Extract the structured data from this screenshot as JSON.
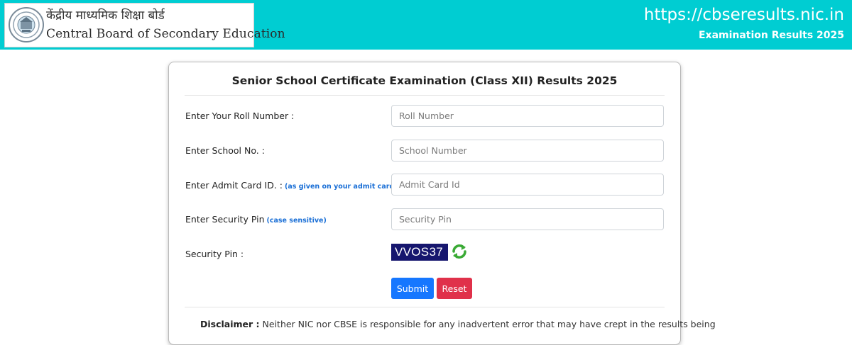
{
  "header": {
    "logo_hindi": "केंद्रीय माध्यमिक शिक्षा बोर्ड",
    "logo_english": "Central Board of Secondary Education",
    "site_url": "https://cbseresults.nic.in",
    "site_subtitle": "Examination Results 2025",
    "brand_color": "#00cdd2"
  },
  "form": {
    "title": "Senior School Certificate Examination (Class XII) Results 2025",
    "roll": {
      "label": "Enter Your Roll Number :",
      "placeholder": "Roll Number",
      "value": ""
    },
    "school": {
      "label": "Enter School No. :",
      "placeholder": "School Number",
      "value": ""
    },
    "admit": {
      "label": "Enter Admit Card ID. :",
      "hint": "(as given on your admit card)",
      "placeholder": "Admit Card Id",
      "value": ""
    },
    "pin": {
      "label": "Enter Security Pin",
      "hint": "(case sensitive)",
      "placeholder": "Security Pin",
      "value": ""
    },
    "captcha": {
      "label": "Security Pin :",
      "code": "VVOS37"
    },
    "submit_label": "Submit",
    "reset_label": "Reset"
  },
  "disclaimer": {
    "heading": "Disclaimer :",
    "text": "Neither NIC nor CBSE is responsible for any inadvertent error that may have crept in the results being"
  },
  "colors": {
    "submit": "#1677ff",
    "reset": "#e0314a",
    "captcha_bg": "#16166e",
    "hint": "#1a6fd6"
  }
}
